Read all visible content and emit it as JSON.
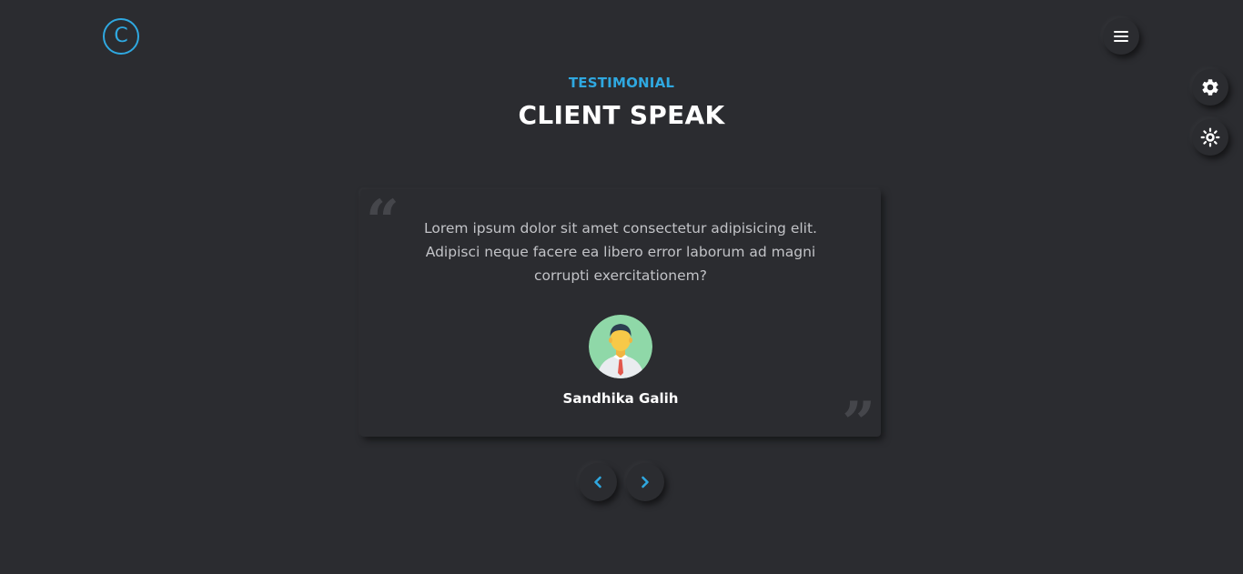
{
  "header": {
    "logo_letter": "C",
    "logo_icon": "circle-c-logo",
    "menu_icon": "hamburger-menu-icon"
  },
  "side_controls": {
    "settings_icon": "gear-icon",
    "theme_icon": "sun-icon"
  },
  "section": {
    "label": "TESTIMONIAL",
    "title": "CLIENT SPEAK"
  },
  "testimonial": {
    "open_quote": "“",
    "close_quote": "”",
    "text": "Lorem ipsum dolor sit amet consectetur adipisicing elit. Adipisci neque facere ea libero error laborum ad magni corrupti exercitationem?",
    "avatar_icon": "person-avatar",
    "name": "Sandhika Galih"
  },
  "carousel": {
    "prev_icon": "chevron-left-icon",
    "next_icon": "chevron-right-icon"
  },
  "colors": {
    "background": "#2b2c30",
    "accent": "#2fa8e0",
    "text": "#ffffff",
    "muted_text": "#c2c3c7"
  }
}
